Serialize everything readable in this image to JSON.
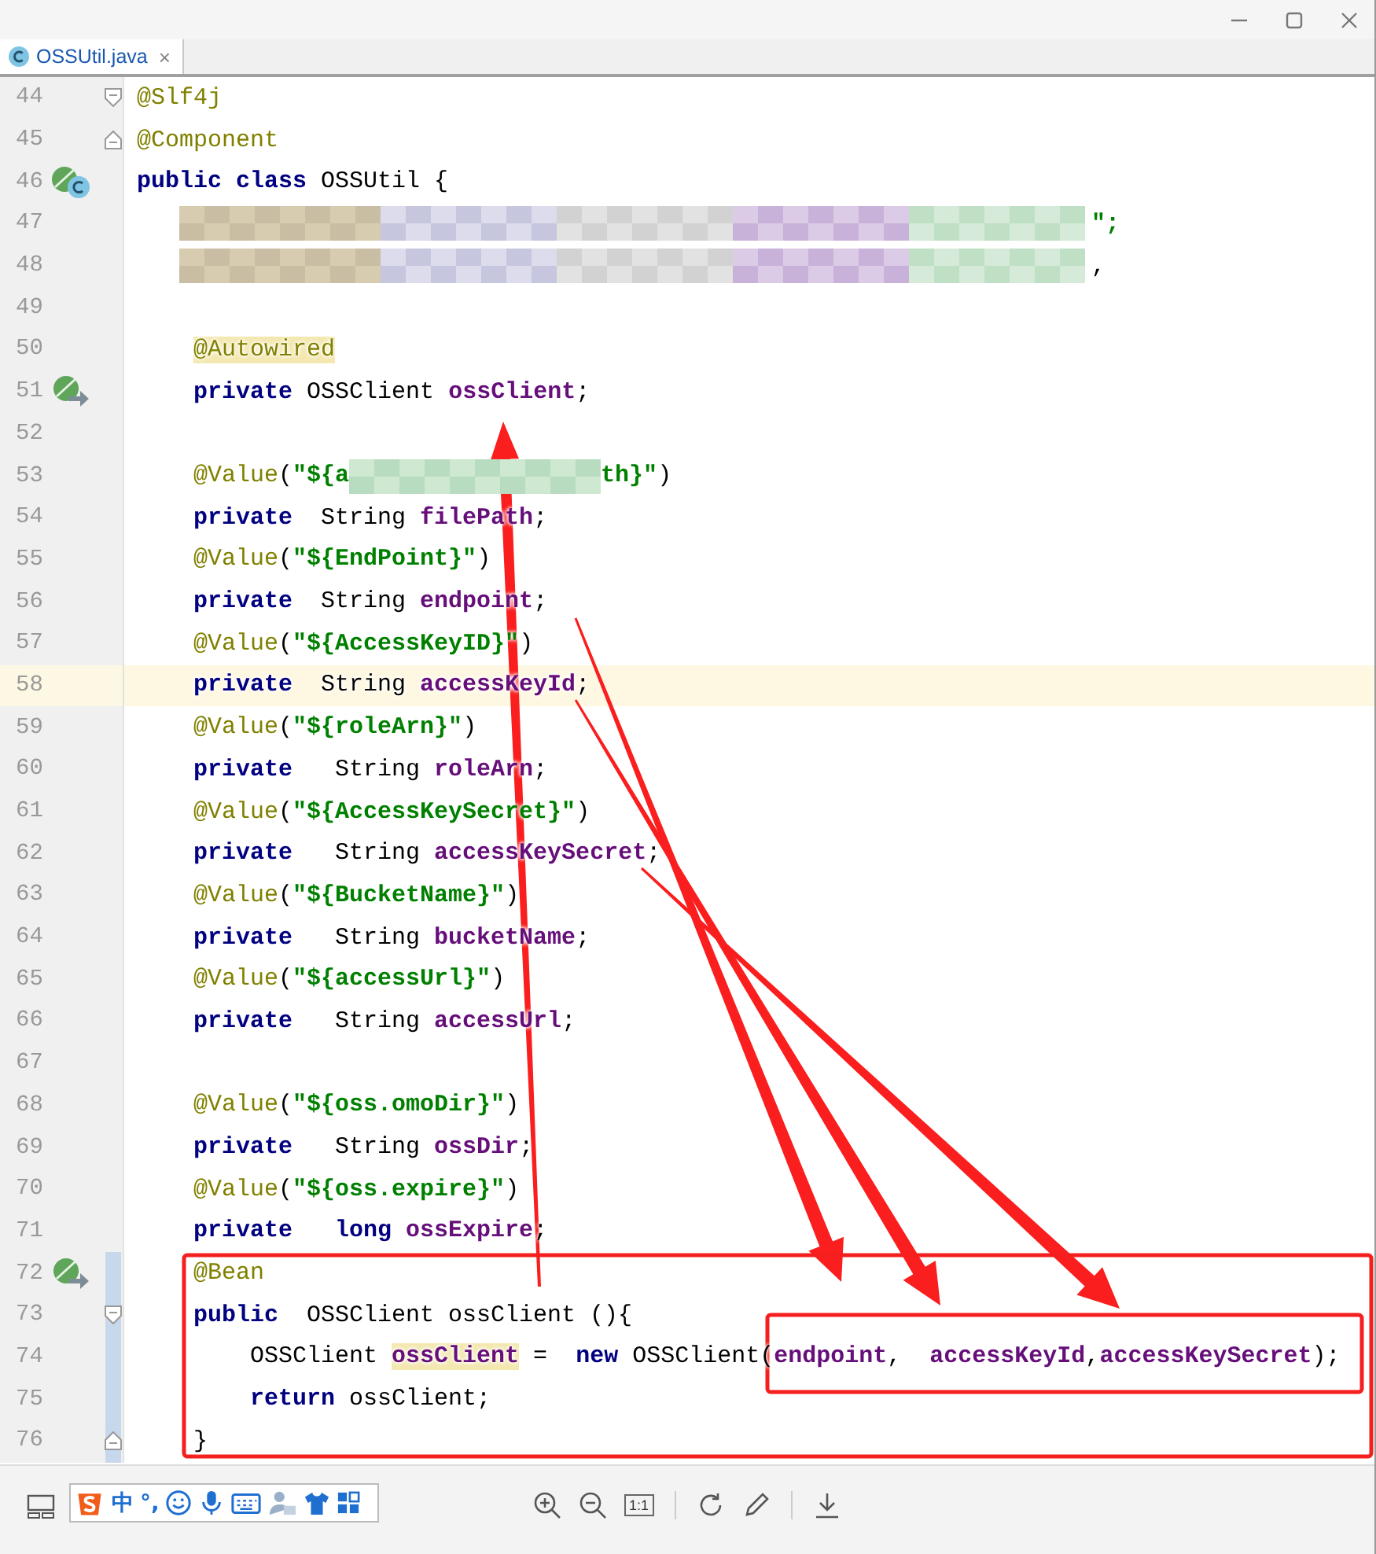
{
  "tabs": [
    {
      "label": "OSSUtil.java",
      "close": "×",
      "selected": true
    }
  ],
  "editor": {
    "lines": [
      {
        "no": "44",
        "kind": "fold-start",
        "current": false,
        "changed": false,
        "tokens": [
          {
            "kind": "annotation",
            "text": "@Slf4j"
          }
        ]
      },
      {
        "no": "45",
        "kind": "fold-end",
        "current": false,
        "changed": false,
        "tokens": [
          {
            "kind": "annotation",
            "text": "@Component"
          }
        ]
      },
      {
        "no": "46",
        "kind": "bean-class",
        "current": false,
        "changed": false,
        "tokens": [
          {
            "kind": "keyword",
            "text": "public class"
          },
          {
            "kind": "text",
            "text": " OSSUtil {"
          }
        ]
      },
      {
        "no": "47",
        "kind": "plain",
        "current": false,
        "changed": false,
        "tokens": [
          {
            "kind": "mosaic-long"
          },
          {
            "kind": "string",
            "text": "\";"
          }
        ]
      },
      {
        "no": "48",
        "kind": "plain",
        "current": false,
        "changed": false,
        "tokens": [
          {
            "kind": "mosaic-long"
          },
          {
            "kind": "text",
            "text": ","
          }
        ]
      },
      {
        "no": "49",
        "kind": "plain",
        "current": false,
        "changed": false
      },
      {
        "no": "50",
        "kind": "plain",
        "current": false,
        "changed": false,
        "tokens": [
          {
            "kind": "annotation-hl",
            "text": "    @Autowired"
          }
        ]
      },
      {
        "no": "51",
        "kind": "bean-arrow",
        "current": false,
        "changed": false,
        "tokens": [
          {
            "kind": "keyword",
            "text": "    private"
          },
          {
            "kind": "text",
            "text": " OSSClient "
          },
          {
            "kind": "field",
            "text": "ossClient"
          },
          {
            "kind": "text",
            "text": ";"
          }
        ]
      },
      {
        "no": "52",
        "kind": "plain",
        "current": false,
        "changed": false
      },
      {
        "no": "53",
        "kind": "plain",
        "current": false,
        "changed": false,
        "tokens": [
          {
            "kind": "annotation",
            "text": "    @Value"
          },
          {
            "kind": "text",
            "text": "("
          },
          {
            "kind": "string",
            "text": "\"${a"
          },
          {
            "kind": "mosaic-short"
          },
          {
            "kind": "string",
            "text": "th}\""
          },
          {
            "kind": "text",
            "text": ")"
          }
        ]
      },
      {
        "no": "54",
        "kind": "plain",
        "current": false,
        "changed": false,
        "tokens": [
          {
            "kind": "keyword",
            "text": "    private"
          },
          {
            "kind": "text",
            "text": "  String "
          },
          {
            "kind": "field",
            "text": "filePath"
          },
          {
            "kind": "text",
            "text": ";"
          }
        ]
      },
      {
        "no": "55",
        "kind": "plain",
        "current": false,
        "changed": false,
        "tokens": [
          {
            "kind": "annotation",
            "text": "    @Value"
          },
          {
            "kind": "text",
            "text": "("
          },
          {
            "kind": "string",
            "text": "\"${EndPoint}\""
          },
          {
            "kind": "text",
            "text": ")"
          }
        ]
      },
      {
        "no": "56",
        "kind": "plain",
        "current": false,
        "changed": false,
        "tokens": [
          {
            "kind": "keyword",
            "text": "    private"
          },
          {
            "kind": "text",
            "text": "  String "
          },
          {
            "kind": "field",
            "text": "endpoint"
          },
          {
            "kind": "text",
            "text": ";"
          }
        ]
      },
      {
        "no": "57",
        "kind": "plain",
        "current": false,
        "changed": false,
        "tokens": [
          {
            "kind": "annotation",
            "text": "    @Value"
          },
          {
            "kind": "text",
            "text": "("
          },
          {
            "kind": "string",
            "text": "\"${AccessKeyID}\""
          },
          {
            "kind": "text",
            "text": ")"
          }
        ]
      },
      {
        "no": "58",
        "kind": "plain",
        "current": true,
        "changed": false,
        "tokens": [
          {
            "kind": "keyword",
            "text": "    private"
          },
          {
            "kind": "text",
            "text": "  String "
          },
          {
            "kind": "field",
            "text": "accessKeyId"
          },
          {
            "kind": "text",
            "text": ";"
          }
        ]
      },
      {
        "no": "59",
        "kind": "plain",
        "current": false,
        "changed": false,
        "tokens": [
          {
            "kind": "annotation",
            "text": "    @Value"
          },
          {
            "kind": "text",
            "text": "("
          },
          {
            "kind": "string",
            "text": "\"${roleArn}\""
          },
          {
            "kind": "text",
            "text": ")"
          }
        ]
      },
      {
        "no": "60",
        "kind": "plain",
        "current": false,
        "changed": false,
        "tokens": [
          {
            "kind": "keyword",
            "text": "    private"
          },
          {
            "kind": "text",
            "text": "   String "
          },
          {
            "kind": "field",
            "text": "roleArn"
          },
          {
            "kind": "text",
            "text": ";"
          }
        ]
      },
      {
        "no": "61",
        "kind": "plain",
        "current": false,
        "changed": false,
        "tokens": [
          {
            "kind": "annotation",
            "text": "    @Value"
          },
          {
            "kind": "text",
            "text": "("
          },
          {
            "kind": "string",
            "text": "\"${AccessKeySecret}\""
          },
          {
            "kind": "text",
            "text": ")"
          }
        ]
      },
      {
        "no": "62",
        "kind": "plain",
        "current": false,
        "changed": false,
        "tokens": [
          {
            "kind": "keyword",
            "text": "    private"
          },
          {
            "kind": "text",
            "text": "   String "
          },
          {
            "kind": "field",
            "text": "accessKeySecret"
          },
          {
            "kind": "text",
            "text": ";"
          }
        ]
      },
      {
        "no": "63",
        "kind": "plain",
        "current": false,
        "changed": false,
        "tokens": [
          {
            "kind": "annotation",
            "text": "    @Value"
          },
          {
            "kind": "text",
            "text": "("
          },
          {
            "kind": "string",
            "text": "\"${BucketName}\""
          },
          {
            "kind": "text",
            "text": ")"
          }
        ]
      },
      {
        "no": "64",
        "kind": "plain",
        "current": false,
        "changed": false,
        "tokens": [
          {
            "kind": "keyword",
            "text": "    private"
          },
          {
            "kind": "text",
            "text": "   String "
          },
          {
            "kind": "field",
            "text": "bucketName"
          },
          {
            "kind": "text",
            "text": ";"
          }
        ]
      },
      {
        "no": "65",
        "kind": "plain",
        "current": false,
        "changed": false,
        "tokens": [
          {
            "kind": "annotation",
            "text": "    @Value"
          },
          {
            "kind": "text",
            "text": "("
          },
          {
            "kind": "string",
            "text": "\"${accessUrl}\""
          },
          {
            "kind": "text",
            "text": ")"
          }
        ]
      },
      {
        "no": "66",
        "kind": "plain",
        "current": false,
        "changed": false,
        "tokens": [
          {
            "kind": "keyword",
            "text": "    private"
          },
          {
            "kind": "text",
            "text": "   String "
          },
          {
            "kind": "field",
            "text": "accessUrl"
          },
          {
            "kind": "text",
            "text": ";"
          }
        ]
      },
      {
        "no": "67",
        "kind": "plain",
        "current": false,
        "changed": false
      },
      {
        "no": "68",
        "kind": "plain",
        "current": false,
        "changed": false,
        "tokens": [
          {
            "kind": "annotation",
            "text": "    @Value"
          },
          {
            "kind": "text",
            "text": "("
          },
          {
            "kind": "string",
            "text": "\"${oss.omoDir}\""
          },
          {
            "kind": "text",
            "text": ")"
          }
        ]
      },
      {
        "no": "69",
        "kind": "plain",
        "current": false,
        "changed": false,
        "tokens": [
          {
            "kind": "keyword",
            "text": "    private"
          },
          {
            "kind": "text",
            "text": "   String "
          },
          {
            "kind": "field",
            "text": "ossDir"
          },
          {
            "kind": "text",
            "text": ";"
          }
        ]
      },
      {
        "no": "70",
        "kind": "plain",
        "current": false,
        "changed": false,
        "tokens": [
          {
            "kind": "annotation",
            "text": "    @Value"
          },
          {
            "kind": "text",
            "text": "("
          },
          {
            "kind": "string",
            "text": "\"${oss.expire}\""
          },
          {
            "kind": "text",
            "text": ")"
          }
        ]
      },
      {
        "no": "71",
        "kind": "plain",
        "current": false,
        "changed": false,
        "tokens": [
          {
            "kind": "keyword",
            "text": "    private"
          },
          {
            "kind": "keyword",
            "text": "   long"
          },
          {
            "kind": "field",
            "text": " ossExpire"
          },
          {
            "kind": "text",
            "text": ";"
          }
        ]
      },
      {
        "no": "72",
        "kind": "bean-arrow",
        "current": false,
        "changed": true,
        "tokens": [
          {
            "kind": "annotation",
            "text": "    @Bean"
          }
        ]
      },
      {
        "no": "73",
        "kind": "fold-start",
        "current": false,
        "changed": true,
        "tokens": [
          {
            "kind": "keyword",
            "text": "    public"
          },
          {
            "kind": "text",
            "text": "  OSSClient ossClient (){"
          }
        ]
      },
      {
        "no": "74",
        "kind": "plain",
        "current": false,
        "changed": true,
        "tokens": [
          {
            "kind": "text",
            "text": "        OSSClient "
          },
          {
            "kind": "field-hl",
            "text": "ossClient"
          },
          {
            "kind": "text",
            "text": " =  "
          },
          {
            "kind": "keyword",
            "text": "new"
          },
          {
            "kind": "text",
            "text": " OSSClient("
          },
          {
            "kind": "field",
            "text": "endpoint"
          },
          {
            "kind": "text",
            "text": ",  "
          },
          {
            "kind": "field",
            "text": "accessKeyId"
          },
          {
            "kind": "text",
            "text": ","
          },
          {
            "kind": "field",
            "text": "accessKeySecret"
          },
          {
            "kind": "text",
            "text": ");"
          }
        ]
      },
      {
        "no": "75",
        "kind": "plain",
        "current": false,
        "changed": true,
        "tokens": [
          {
            "kind": "keyword",
            "text": "        return"
          },
          {
            "kind": "text",
            "text": " ossClient;"
          }
        ]
      },
      {
        "no": "76",
        "kind": "fold-end",
        "current": false,
        "changed": true,
        "tokens": [
          {
            "kind": "text",
            "text": "    }"
          }
        ]
      }
    ]
  },
  "annotations": [
    {
      "kind": "arrow"
    },
    {
      "kind": "arrow"
    },
    {
      "kind": "arrow"
    },
    {
      "kind": "arrow"
    },
    {
      "kind": "box"
    },
    {
      "kind": "box"
    }
  ],
  "ime_toolbar": {
    "labels": [
      "中",
      "°,"
    ]
  },
  "viewer_toolbar": {
    "actual_size": "1:1"
  }
}
